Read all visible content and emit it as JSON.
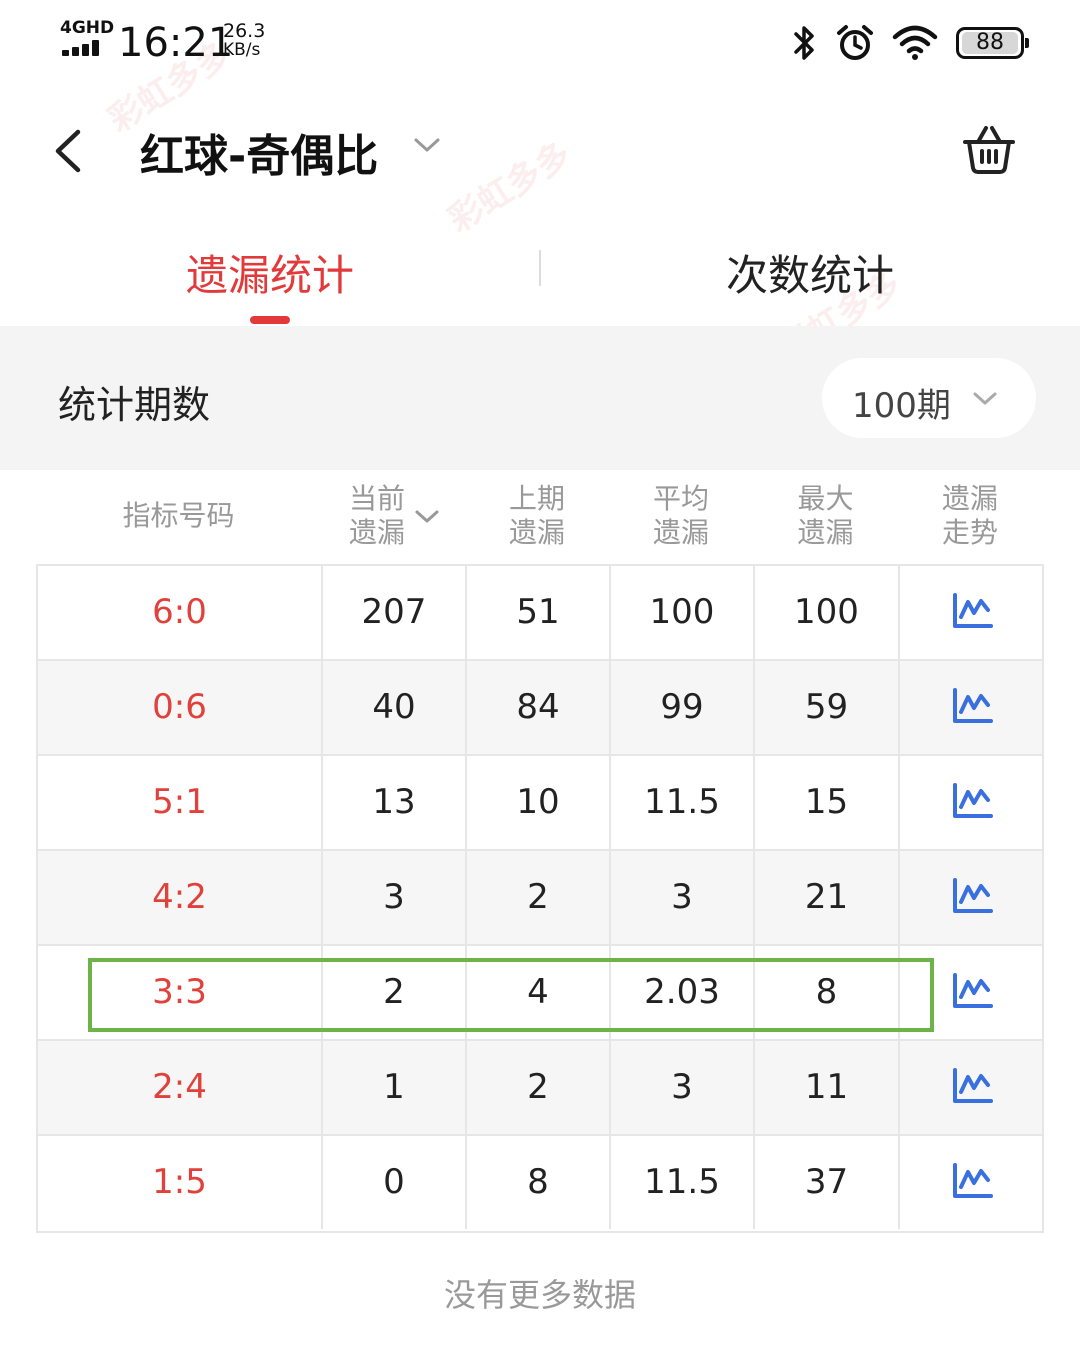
{
  "status": {
    "net_type": "4GHD",
    "time": "16:21",
    "speed_value": "26.3",
    "speed_unit": "KB/s",
    "battery": "88",
    "icons": [
      "bluetooth-icon",
      "alarm-icon",
      "wifi-icon",
      "battery-icon"
    ]
  },
  "header": {
    "title": "红球-奇偶比",
    "icons": [
      "back-icon",
      "chevron-down-icon",
      "basket-icon"
    ]
  },
  "tabs": [
    {
      "label": "遗漏统计",
      "active": true
    },
    {
      "label": "次数统计",
      "active": false
    }
  ],
  "period": {
    "label": "统计期数",
    "value": "100期"
  },
  "table": {
    "headers": [
      {
        "line1": "指标号码",
        "line2": ""
      },
      {
        "line1": "当前",
        "line2": "遗漏"
      },
      {
        "line1": "上期",
        "line2": "遗漏"
      },
      {
        "line1": "平均",
        "line2": "遗漏"
      },
      {
        "line1": "最大",
        "line2": "遗漏"
      },
      {
        "line1": "遗漏",
        "line2": "走势"
      }
    ],
    "rows": [
      {
        "code": "6:0",
        "current": "207",
        "previous": "51",
        "average": "100",
        "max": "100"
      },
      {
        "code": "0:6",
        "current": "40",
        "previous": "84",
        "average": "99",
        "max": "59"
      },
      {
        "code": "5:1",
        "current": "13",
        "previous": "10",
        "average": "11.5",
        "max": "15"
      },
      {
        "code": "4:2",
        "current": "3",
        "previous": "2",
        "average": "3",
        "max": "21"
      },
      {
        "code": "3:3",
        "current": "2",
        "previous": "4",
        "average": "2.03",
        "max": "8"
      },
      {
        "code": "2:4",
        "current": "1",
        "previous": "2",
        "average": "3",
        "max": "11"
      },
      {
        "code": "1:5",
        "current": "0",
        "previous": "8",
        "average": "11.5",
        "max": "37"
      }
    ],
    "highlighted_row": "3:3",
    "highlight_color": "#6db347",
    "trend_icon": "trend-chart-icon"
  },
  "footer": {
    "no_more": "没有更多数据"
  },
  "watermark": "彩虹多多",
  "colors": {
    "accent": "#e23a3a",
    "code_text": "#e0413a",
    "trend_icon": "#3a6fe0"
  }
}
